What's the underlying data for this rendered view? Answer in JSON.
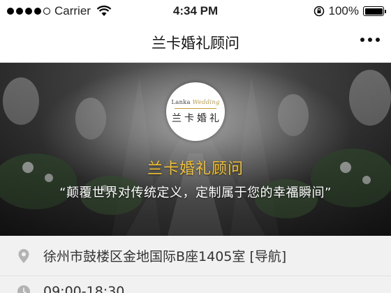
{
  "status_bar": {
    "carrier": "Carrier",
    "time": "4:34 PM",
    "battery": "100%"
  },
  "header": {
    "title": "兰卡婚礼顾问"
  },
  "hero": {
    "logo_en_part1": "Lanka",
    "logo_en_part2": "Wedding",
    "logo_cn": "兰卡婚礼",
    "title": "兰卡婚礼顾问",
    "slogan": "“颠覆世界对传统定义，定制属于您的幸福瞬间”"
  },
  "info": {
    "address": "徐州市鼓楼区金地国际B座1405室",
    "nav_label": "[导航]",
    "hours": "09:00-18:30"
  },
  "colors": {
    "accent_gold": "#f2c02e",
    "icon_gray": "#b3b3b3"
  }
}
